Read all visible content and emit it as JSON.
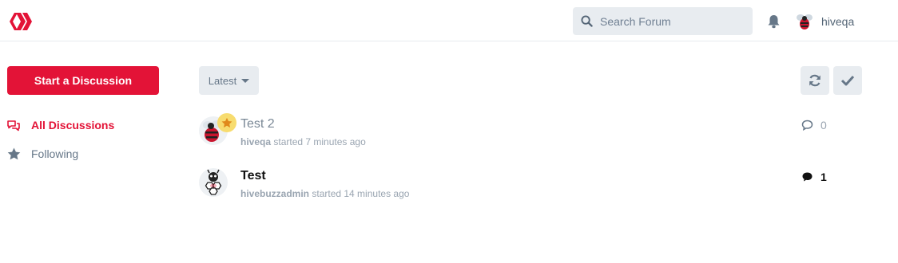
{
  "header": {
    "search_placeholder": "Search Forum",
    "username": "hiveqa"
  },
  "sidebar": {
    "start_button_label": "Start a Discussion",
    "items": [
      {
        "label": "All Discussions",
        "icon": "comments-icon",
        "active": true
      },
      {
        "label": "Following",
        "icon": "star-icon",
        "active": false
      }
    ]
  },
  "toolbar": {
    "sort_label": "Latest",
    "refresh_icon": "refresh-icon",
    "mark_read_icon": "check-icon"
  },
  "discussions": [
    {
      "title": "Test 2",
      "author": "hiveqa",
      "started_text": "started 7 minutes ago",
      "reply_count": "0",
      "unread": false
    },
    {
      "title": "Test",
      "author": "hivebuzzadmin",
      "started_text": "started 14 minutes ago",
      "reply_count": "1",
      "unread": true
    }
  ],
  "colors": {
    "accent": "#e31337",
    "muted": "#667788",
    "control_bg": "#e8ecf0"
  }
}
